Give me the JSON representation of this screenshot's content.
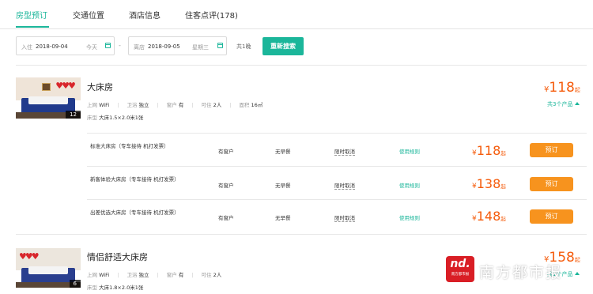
{
  "tabs": [
    {
      "label": "房型预订",
      "active": true
    },
    {
      "label": "交通位置",
      "active": false
    },
    {
      "label": "酒店信息",
      "active": false
    },
    {
      "label": "住客点评(178)",
      "active": false
    }
  ],
  "search": {
    "checkin_label": "入住",
    "checkin_date": "2018-09-04",
    "checkin_weekday": "今天",
    "separator": "-",
    "checkout_label": "离店",
    "checkout_date": "2018-09-05",
    "checkout_weekday": "星期三",
    "nights": "共1晚",
    "button": "重新搜索"
  },
  "rooms": [
    {
      "name": "大床房",
      "photo_count": "12",
      "amenities": {
        "wifi_label": "上网",
        "wifi": "WiFi",
        "bath_label": "卫浴",
        "bath": "独立",
        "window_label": "窗户",
        "window": "有",
        "capacity_label": "可住",
        "capacity": "2人",
        "area_label": "面积",
        "area": "16㎡"
      },
      "bed_label": "床型",
      "bed": "大床1.5×2.0米1张",
      "currency": "¥",
      "price": "118",
      "price_suffix": "起",
      "products": "共3个产品",
      "rates": [
        {
          "name": "标准大床房（专车接待 机打发票）",
          "window": "有窗户",
          "breakfast": "无早餐",
          "cancel": "限时取消",
          "rules": "使用规则",
          "currency": "¥",
          "price": "118",
          "suffix": "起",
          "button": "预订"
        },
        {
          "name": "新客体验大床房（专车接待 机打发票）",
          "window": "有窗户",
          "breakfast": "无早餐",
          "cancel": "限时取消",
          "rules": "使用规则",
          "currency": "¥",
          "price": "138",
          "suffix": "起",
          "button": "预订"
        },
        {
          "name": "出差优选大床房（专车接待 机打发票）",
          "window": "有窗户",
          "breakfast": "无早餐",
          "cancel": "限时取消",
          "rules": "使用规则",
          "currency": "¥",
          "price": "148",
          "suffix": "起",
          "button": "预订"
        }
      ]
    },
    {
      "name": "情侣舒适大床房",
      "photo_count": "6",
      "amenities": {
        "wifi_label": "上网",
        "wifi": "WiFi",
        "bath_label": "卫浴",
        "bath": "独立",
        "window_label": "窗户",
        "window": "有",
        "capacity_label": "可住",
        "capacity": "2人"
      },
      "bed_label": "床型",
      "bed": "大床1.8×2.0米1张",
      "currency": "¥",
      "price": "158",
      "price_suffix": "起",
      "products": "共1个产品"
    }
  ],
  "watermark": {
    "logo": "nd.",
    "logo_sub": "南方都市报",
    "text": "南方都市报"
  },
  "colors": {
    "accent": "#1bb69a",
    "price": "#f55b0b",
    "book": "#f7931e"
  }
}
